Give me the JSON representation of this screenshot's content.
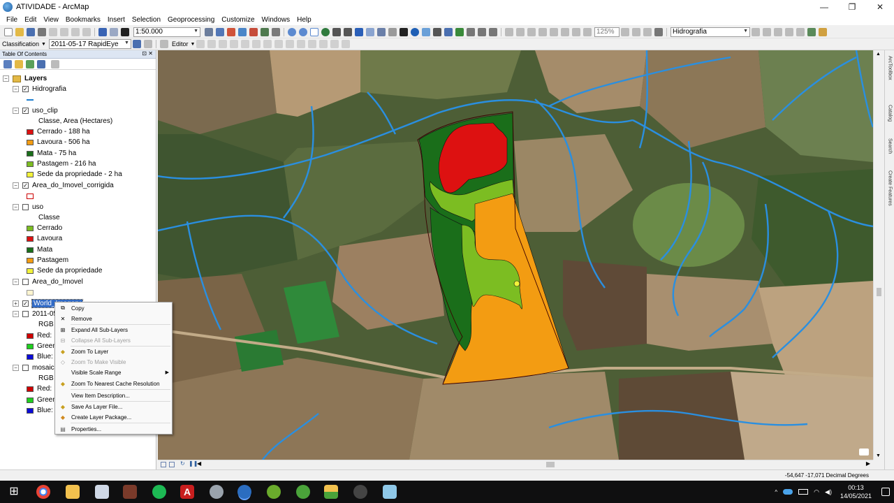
{
  "window": {
    "title": "ATIVIDADE - ArcMap",
    "minimize": "—",
    "maximize": "❐",
    "close": "✕"
  },
  "menu": [
    "File",
    "Edit",
    "View",
    "Bookmarks",
    "Insert",
    "Selection",
    "Geoprocessing",
    "Customize",
    "Windows",
    "Help"
  ],
  "toolbar": {
    "scale": "1:50.000",
    "zoom_percent": "125%",
    "target_layer": "Hidrografia",
    "classification_label": "Classification",
    "image_dropdown": "2011-05-17 RapidEye",
    "editor_label": "Editor"
  },
  "toc": {
    "title": "Table Of Contents",
    "header_buttons": "⊡ ✕",
    "root": "Layers",
    "layers": {
      "hidrografia": "Hidrografia",
      "uso_clip": "uso_clip",
      "uso_clip_field": "Classe, Area (Hectares)",
      "uso_clip_items": [
        "Cerrado - 188 ha",
        "Lavoura - 506 ha",
        "Mata - 75 ha",
        "Pastagem - 216 ha",
        "Sede da propriedade - 2 ha"
      ],
      "area_corrigida": "Area_do_Imovel_corrigida",
      "uso": "uso",
      "uso_field": "Classe",
      "uso_items": [
        "Cerrado",
        "Lavoura",
        "Mata",
        "Pastagem",
        "Sede da propriedade"
      ],
      "area_imovel": "Area_do_Imovel",
      "world_imagery": "World_Imagery",
      "rapideye": "2011-05",
      "rgb": "RGB",
      "red": "Red:",
      "green": "Green",
      "blue": "Blue:",
      "mosaico": "mosaico",
      "rgb2": "RGB",
      "red2": "Red:",
      "green2": "Green",
      "blue2": "Blue:"
    }
  },
  "legend_colors": {
    "cerrado": "#dd1111",
    "lavoura": "#f39c12",
    "mata": "#1a6e1a",
    "pastagem": "#7cbd22",
    "sede": "#f2f23a",
    "uso_cerrado": "#7cbd22",
    "uso_lavoura": "#dd1111",
    "uso_mata": "#1a6e1a",
    "uso_pastagem": "#f39c12",
    "uso_sede": "#f2f23a",
    "river": "#2a8fe0"
  },
  "context_menu": [
    {
      "label": "Copy",
      "icon": "copy-icon",
      "disabled": false
    },
    {
      "label": "Remove",
      "icon": "remove-icon",
      "disabled": false
    },
    {
      "label": "Expand All Sub-Layers",
      "icon": "expand-icon",
      "disabled": false
    },
    {
      "label": "Collapse All Sub-Layers",
      "icon": "collapse-icon",
      "disabled": true
    },
    {
      "label": "Zoom To Layer",
      "icon": "zoom-layer-icon",
      "disabled": false
    },
    {
      "label": "Zoom To Make Visible",
      "icon": "zoom-visible-icon",
      "disabled": true
    },
    {
      "label": "Visible Scale Range",
      "icon": "",
      "disabled": false
    },
    {
      "label": "Zoom To Nearest Cache Resolution",
      "icon": "zoom-cache-icon",
      "disabled": false
    },
    {
      "label": "View Item Description...",
      "icon": "",
      "disabled": false
    },
    {
      "label": "Save As Layer File...",
      "icon": "save-layer-icon",
      "disabled": false
    },
    {
      "label": "Create Layer Package...",
      "icon": "layer-package-icon",
      "disabled": false
    },
    {
      "label": "Properties...",
      "icon": "properties-icon",
      "disabled": false
    }
  ],
  "right_dock": [
    "ArcToolbox",
    "Catalog",
    "Search",
    "Create Features"
  ],
  "status": {
    "coords": "-54,647  -17,071 Decimal Degrees"
  },
  "taskbar": {
    "time": "00:13",
    "date": "14/05/2021"
  }
}
